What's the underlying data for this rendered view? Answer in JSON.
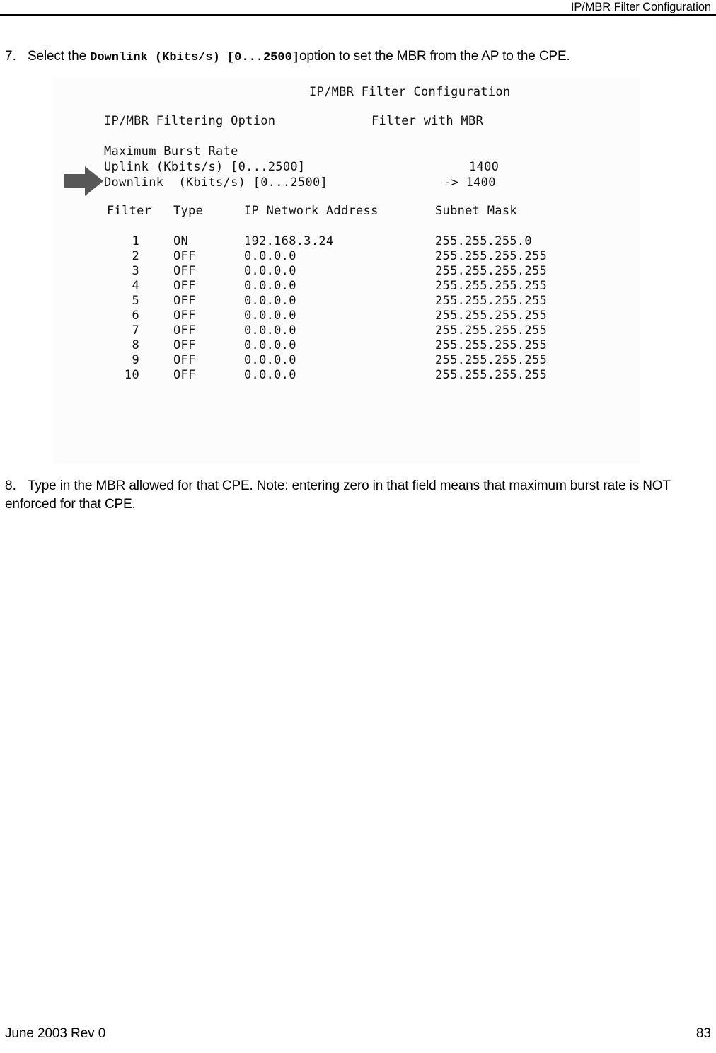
{
  "header": {
    "title": "IP/MBR Filter Configuration"
  },
  "steps": [
    {
      "number": "7.",
      "text_before": "Select the ",
      "mono_text": "Downlink (Kbits/s) [0...2500]",
      "text_after": "option to set the MBR from the AP to the CPE."
    },
    {
      "number": "8.",
      "text": "Type in the MBR allowed for that CPE. Note: entering zero in that field means that maximum burst rate is NOT enforced for that CPE."
    }
  ],
  "terminal": {
    "title": "IP/MBR Filter Configuration",
    "option_label": "IP/MBR Filtering Option",
    "option_value": "Filter with MBR",
    "mbr_heading": "Maximum Burst Rate",
    "uplink_label": "Uplink (Kbits/s) [0...2500]",
    "uplink_value": "1400",
    "downlink_label": "Downlink  (Kbits/s) [0...2500]",
    "downlink_value": "-> 1400",
    "cursor_icon": "right-arrow-icon",
    "cursor_color": "#575757",
    "table": {
      "headers": {
        "filter": "Filter",
        "type": "Type",
        "ip": "IP Network Address",
        "mask": "Subnet Mask"
      },
      "rows": [
        {
          "filter": "1",
          "type": "ON",
          "ip": "192.168.3.24",
          "mask": "255.255.255.0"
        },
        {
          "filter": "2",
          "type": "OFF",
          "ip": "0.0.0.0",
          "mask": "255.255.255.255"
        },
        {
          "filter": "3",
          "type": "OFF",
          "ip": "0.0.0.0",
          "mask": "255.255.255.255"
        },
        {
          "filter": "4",
          "type": "OFF",
          "ip": "0.0.0.0",
          "mask": "255.255.255.255"
        },
        {
          "filter": "5",
          "type": "OFF",
          "ip": "0.0.0.0",
          "mask": "255.255.255.255"
        },
        {
          "filter": "6",
          "type": "OFF",
          "ip": "0.0.0.0",
          "mask": "255.255.255.255"
        },
        {
          "filter": "7",
          "type": "OFF",
          "ip": "0.0.0.0",
          "mask": "255.255.255.255"
        },
        {
          "filter": "8",
          "type": "OFF",
          "ip": "0.0.0.0",
          "mask": "255.255.255.255"
        },
        {
          "filter": "9",
          "type": "OFF",
          "ip": "0.0.0.0",
          "mask": "255.255.255.255"
        },
        {
          "filter": "10",
          "type": "OFF",
          "ip": "0.0.0.0",
          "mask": "255.255.255.255"
        }
      ]
    }
  },
  "footer": {
    "left": "June 2003 Rev 0",
    "page_number": "83"
  }
}
